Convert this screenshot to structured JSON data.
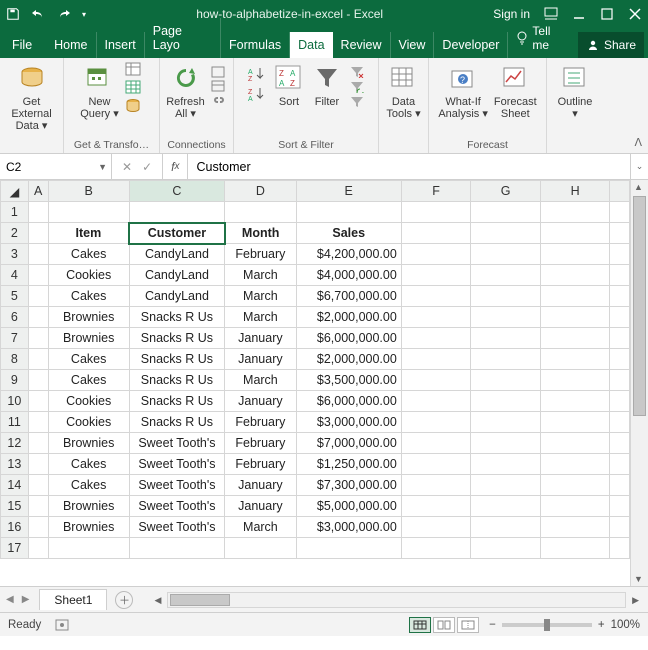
{
  "titlebar": {
    "title": "how-to-alphabetize-in-excel - Excel",
    "signin": "Sign in"
  },
  "menu": {
    "file": "File",
    "tabs": [
      "Home",
      "Insert",
      "Page Layo",
      "Formulas",
      "Data",
      "Review",
      "View",
      "Developer"
    ],
    "active": "Data",
    "tellme": "Tell me",
    "share": "Share"
  },
  "ribbon": {
    "get_external": "Get External\nData ▾",
    "new_query": "New\nQuery ▾",
    "group_transform": "Get & Transfo…",
    "refresh_all": "Refresh\nAll ▾",
    "group_connections": "Connections",
    "sort": "Sort",
    "group_sortfilter": "Sort & Filter",
    "filter": "Filter",
    "data_tools": "Data\nTools ▾",
    "whatif": "What-If\nAnalysis ▾",
    "forecast_sheet": "Forecast\nSheet",
    "group_forecast": "Forecast",
    "outline": "Outline\n▾"
  },
  "namebox": {
    "ref": "C2"
  },
  "formula": {
    "value": "Customer"
  },
  "columns": [
    "A",
    "B",
    "C",
    "D",
    "E",
    "F",
    "G",
    "H"
  ],
  "headers": {
    "B": "Item",
    "C": "Customer",
    "D": "Month",
    "E": "Sales"
  },
  "rows": [
    {
      "n": 3,
      "B": "Cakes",
      "C": "CandyLand",
      "D": "February",
      "E": "$4,200,000.00"
    },
    {
      "n": 4,
      "B": "Cookies",
      "C": "CandyLand",
      "D": "March",
      "E": "$4,000,000.00"
    },
    {
      "n": 5,
      "B": "Cakes",
      "C": "CandyLand",
      "D": "March",
      "E": "$6,700,000.00"
    },
    {
      "n": 6,
      "B": "Brownies",
      "C": "Snacks R Us",
      "D": "March",
      "E": "$2,000,000.00"
    },
    {
      "n": 7,
      "B": "Brownies",
      "C": "Snacks R Us",
      "D": "January",
      "E": "$6,000,000.00"
    },
    {
      "n": 8,
      "B": "Cakes",
      "C": "Snacks R Us",
      "D": "January",
      "E": "$2,000,000.00"
    },
    {
      "n": 9,
      "B": "Cakes",
      "C": "Snacks R Us",
      "D": "March",
      "E": "$3,500,000.00"
    },
    {
      "n": 10,
      "B": "Cookies",
      "C": "Snacks R Us",
      "D": "January",
      "E": "$6,000,000.00"
    },
    {
      "n": 11,
      "B": "Cookies",
      "C": "Snacks R Us",
      "D": "February",
      "E": "$3,000,000.00"
    },
    {
      "n": 12,
      "B": "Brownies",
      "C": "Sweet Tooth's",
      "D": "February",
      "E": "$7,000,000.00"
    },
    {
      "n": 13,
      "B": "Cakes",
      "C": "Sweet Tooth's",
      "D": "February",
      "E": "$1,250,000.00"
    },
    {
      "n": 14,
      "B": "Cakes",
      "C": "Sweet Tooth's",
      "D": "January",
      "E": "$7,300,000.00"
    },
    {
      "n": 15,
      "B": "Brownies",
      "C": "Sweet Tooth's",
      "D": "January",
      "E": "$5,000,000.00"
    },
    {
      "n": 16,
      "B": "Brownies",
      "C": "Sweet Tooth's",
      "D": "March",
      "E": "$3,000,000.00"
    }
  ],
  "sheet": {
    "name": "Sheet1"
  },
  "status": {
    "ready": "Ready",
    "zoom": "100%"
  }
}
